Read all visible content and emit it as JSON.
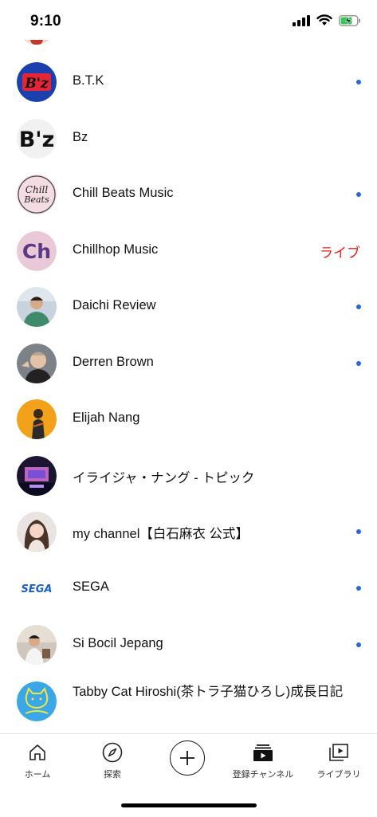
{
  "status_bar": {
    "time": "9:10"
  },
  "channels": [
    {
      "name": "B.T.K",
      "new_content": true,
      "live": false,
      "icon": "btk-logo-avatar"
    },
    {
      "name": "Bz",
      "new_content": false,
      "live": false,
      "icon": "bz-logo-avatar"
    },
    {
      "name": "Chill Beats Music",
      "new_content": true,
      "live": false,
      "icon": "chill-beats-avatar"
    },
    {
      "name": "Chillhop Music",
      "new_content": false,
      "live": true,
      "live_label": "ライブ",
      "icon": "chillhop-avatar"
    },
    {
      "name": "Daichi Review",
      "new_content": true,
      "live": false,
      "icon": "person-avatar"
    },
    {
      "name": "Derren Brown",
      "new_content": true,
      "live": false,
      "icon": "person-avatar"
    },
    {
      "name": "Elijah Nang",
      "new_content": false,
      "live": false,
      "icon": "person-avatar"
    },
    {
      "name": "イライジャ・ナング - トピック",
      "new_content": false,
      "live": false,
      "icon": "topic-avatar"
    },
    {
      "name": "my channel【白石麻衣 公式】",
      "new_content": true,
      "live": false,
      "icon": "person-avatar"
    },
    {
      "name": "SEGA",
      "new_content": true,
      "live": false,
      "icon": "sega-logo-avatar"
    },
    {
      "name": "Si Bocil Jepang",
      "new_content": true,
      "live": false,
      "icon": "person-avatar"
    },
    {
      "name": "Tabby Cat Hiroshi(茶トラ子猫ひろし)成長日記",
      "new_content": false,
      "live": false,
      "icon": "cat-logo-avatar"
    }
  ],
  "bottom_nav": {
    "home_label": "ホーム",
    "explore_label": "探索",
    "subscriptions_label": "登録チャンネル",
    "library_label": "ライブラリ"
  },
  "colors": {
    "new_dot": "#2266ee",
    "live": "#e62117",
    "text": "#111111"
  }
}
